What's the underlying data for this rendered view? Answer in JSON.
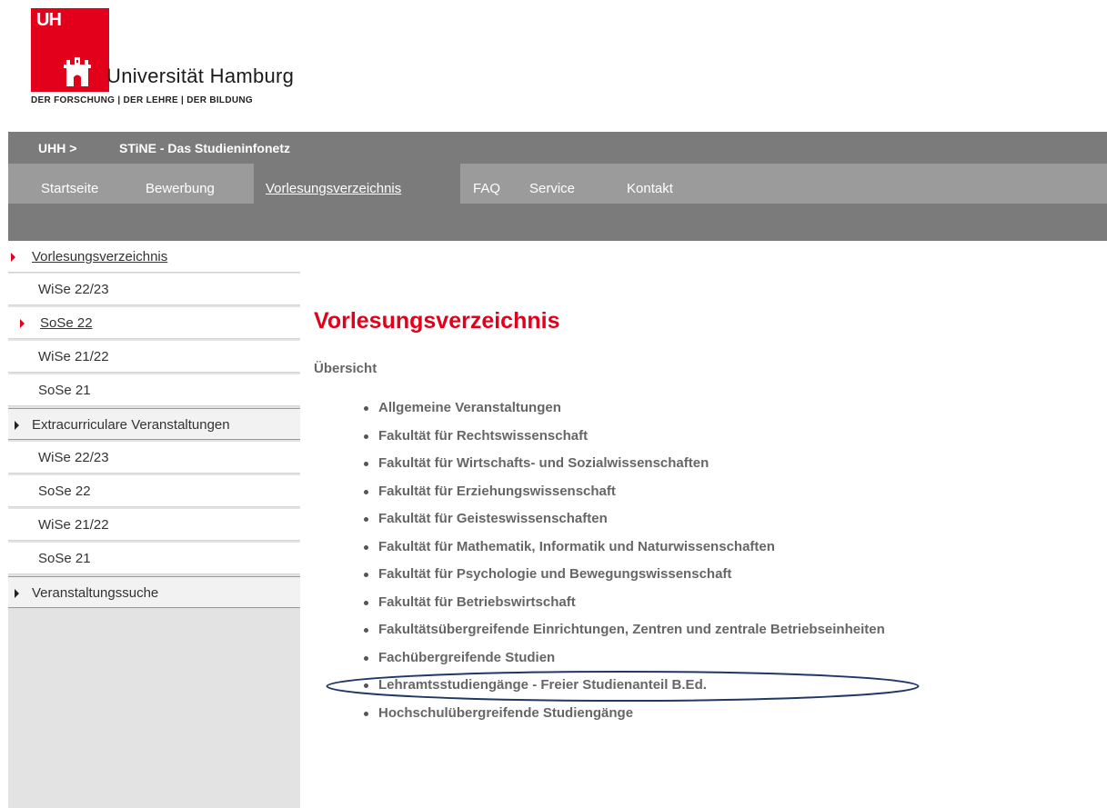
{
  "logo": {
    "mark": "UH",
    "name": "Universität Hamburg",
    "tagline": "DER FORSCHUNG | DER LEHRE | DER BILDUNG",
    "brand_color": "#e2001a"
  },
  "header": {
    "crumb_root": "UHH >",
    "crumb_site": "STiNE - Das Studieninfonetz"
  },
  "nav": {
    "items": [
      "Startseite",
      "Bewerbung",
      "Vorlesungsverzeichnis",
      "FAQ",
      "Service",
      "Kontakt"
    ],
    "active": "Vorlesungsverzeichnis"
  },
  "sidebar": {
    "items": [
      {
        "label": "Vorlesungsverzeichnis",
        "type": "head"
      },
      {
        "label": "WiSe 22/23",
        "type": "sub"
      },
      {
        "label": "SoSe 22",
        "type": "sub-active"
      },
      {
        "label": "WiSe 21/22",
        "type": "sub"
      },
      {
        "label": "SoSe 21",
        "type": "sub"
      },
      {
        "label": "Extracurriculare Veranstaltungen",
        "type": "head"
      },
      {
        "label": "WiSe 22/23",
        "type": "sub"
      },
      {
        "label": "SoSe 22",
        "type": "sub"
      },
      {
        "label": "WiSe 21/22",
        "type": "sub"
      },
      {
        "label": "SoSe 21",
        "type": "sub"
      },
      {
        "label": "Veranstaltungssuche",
        "type": "head"
      }
    ]
  },
  "main": {
    "title": "Vorlesungsverzeichnis",
    "subtitle": "Übersicht",
    "faculties": [
      "Allgemeine Veranstaltungen",
      "Fakultät für Rechtswissenschaft",
      "Fakultät für Wirtschafts- und Sozialwissenschaften",
      "Fakultät für Erziehungswissenschaft",
      "Fakultät für Geisteswissenschaften",
      "Fakultät für Mathematik, Informatik und Naturwissenschaften",
      "Fakultät für Psychologie und Bewegungswissenschaft",
      "Fakultät für Betriebswirtschaft",
      "Fakultätsübergreifende Einrichtungen, Zentren und zentrale Betriebseinheiten",
      "Fachübergreifende Studien",
      "Lehramtsstudiengänge - Freier Studienanteil B.Ed.",
      "Hochschulübergreifende Studiengänge"
    ],
    "highlighted": "Lehramtsstudiengänge - Freier Studienanteil B.Ed."
  }
}
